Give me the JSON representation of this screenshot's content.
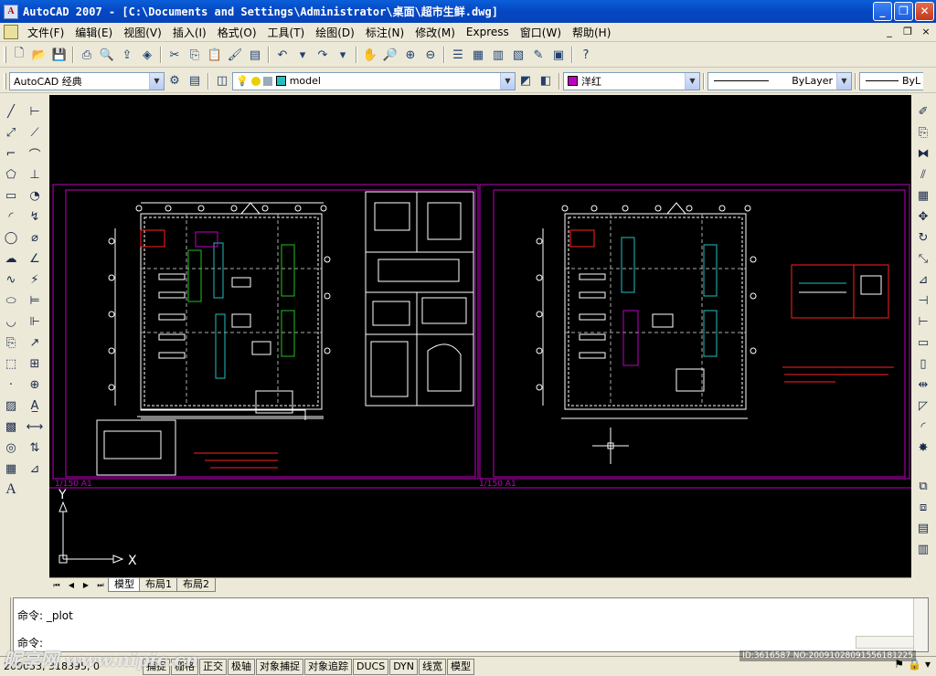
{
  "titlebar": {
    "app_icon": "A",
    "title": "AutoCAD 2007 - [C:\\Documents and Settings\\Administrator\\桌面\\超市生鲜.dwg]",
    "minimize": "_",
    "restore": "❐",
    "close": "✕"
  },
  "menu": {
    "items": [
      "文件(F)",
      "编辑(E)",
      "视图(V)",
      "插入(I)",
      "格式(O)",
      "工具(T)",
      "绘图(D)",
      "标注(N)",
      "修改(M)",
      "Express",
      "窗口(W)",
      "帮助(H)"
    ],
    "doc_minimize": "_",
    "doc_restore": "❐",
    "doc_close": "×"
  },
  "toolbar2": {
    "workspace": "AutoCAD 经典",
    "layer": "model",
    "color": "洋红",
    "color_hex": "#c000c0",
    "linetype": "ByLayer",
    "lineweight": "ByL"
  },
  "tabs": {
    "nav": [
      "⏮",
      "◀",
      "▶",
      "⏭"
    ],
    "items": [
      "模型",
      "布局1",
      "布局2"
    ]
  },
  "command": {
    "line1": "命令: _plot",
    "line2": "命令:"
  },
  "statusbar": {
    "coords": "209053, 318395, 0",
    "buttons": [
      "捕捉",
      "栅格",
      "正交",
      "极轴",
      "对象捕捉",
      "对象追踪",
      "DUCS",
      "DYN",
      "线宽",
      "模型"
    ]
  },
  "drawing": {
    "scale_left": "1/150 A1",
    "scale_right": "1/150 A1",
    "ucs_x": "X",
    "ucs_y": "Y"
  },
  "watermark": {
    "text": "昵享网 www.nipic.cn",
    "id": "ID:3616587 NO:20091028091556181225"
  },
  "colors": {
    "cad_background": "#000000",
    "magenta": "#c000c0",
    "red": "#ff2020",
    "white": "#ffffff",
    "green": "#20c020",
    "cyan": "#20c0c0"
  }
}
